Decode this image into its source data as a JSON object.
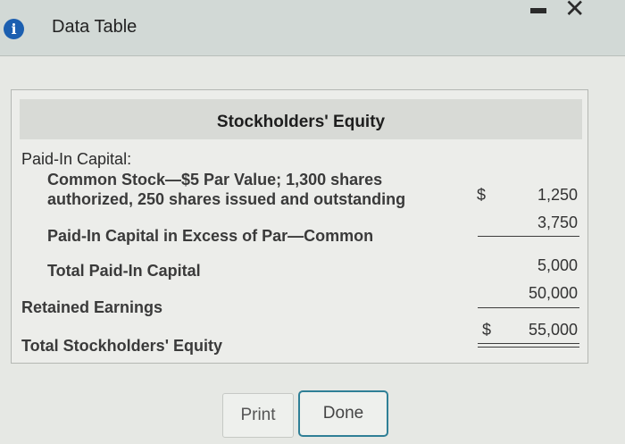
{
  "window": {
    "title": "Data Table"
  },
  "table": {
    "heading": "Stockholders' Equity",
    "paid_in_capital_label": "Paid-In Capital:",
    "common_stock_line1": "Common Stock—$5 Par Value; 1,300 shares",
    "common_stock_line2": "authorized, 250 shares issued and outstanding",
    "common_stock_dollar": "$",
    "common_stock_value": "1,250",
    "excess_par_label": "Paid-In Capital in Excess of Par—Common",
    "excess_par_value": "3,750",
    "total_paid_in_label": "Total Paid-In Capital",
    "total_paid_in_value": "5,000",
    "retained_earnings_label": "Retained Earnings",
    "retained_earnings_value": "50,000",
    "total_equity_label": "Total Stockholders' Equity",
    "total_equity_dollar": "$",
    "total_equity_value": "55,000"
  },
  "buttons": {
    "print_label": "Print",
    "done_label": "Done"
  }
}
